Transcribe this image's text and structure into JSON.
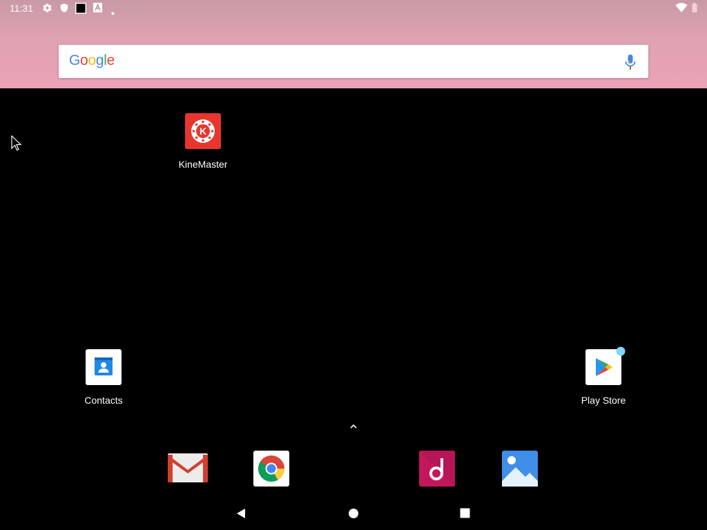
{
  "status_bar": {
    "time": "11:31",
    "left_icons": [
      "gear-icon",
      "shield-icon",
      "square-icon",
      "font-a-icon",
      "dot-icon"
    ],
    "right_icons": [
      "wifi-icon",
      "battery-icon"
    ]
  },
  "search": {
    "logo": [
      "G",
      "o",
      "o",
      "g",
      "l",
      "e"
    ],
    "mic_icon": "mic-icon"
  },
  "home_apps": [
    {
      "label": "KineMaster",
      "icon": "kinemaster-icon"
    },
    {
      "label": "Contacts",
      "icon": "contacts-icon"
    },
    {
      "label": "Play Store",
      "icon": "play-store-icon"
    }
  ],
  "drawer_handle": {
    "glyph": "˄"
  },
  "dock": [
    {
      "name": "Gmail",
      "icon": "gmail-icon"
    },
    {
      "name": "Chrome",
      "icon": "chrome-icon"
    },
    {
      "name": "Music",
      "icon": "music-icon"
    },
    {
      "name": "Photos",
      "icon": "photos-icon"
    }
  ],
  "nav": {
    "back": "back-icon",
    "home": "home-icon",
    "recents": "recents-icon"
  },
  "colors": {
    "wallpaper_top": "#eaa3b6",
    "kinemaster_red": "#e8362e",
    "contacts_blue": "#1e88e5",
    "music_magenta": "#c2185b",
    "photos_blue": "#3f8ee8"
  }
}
